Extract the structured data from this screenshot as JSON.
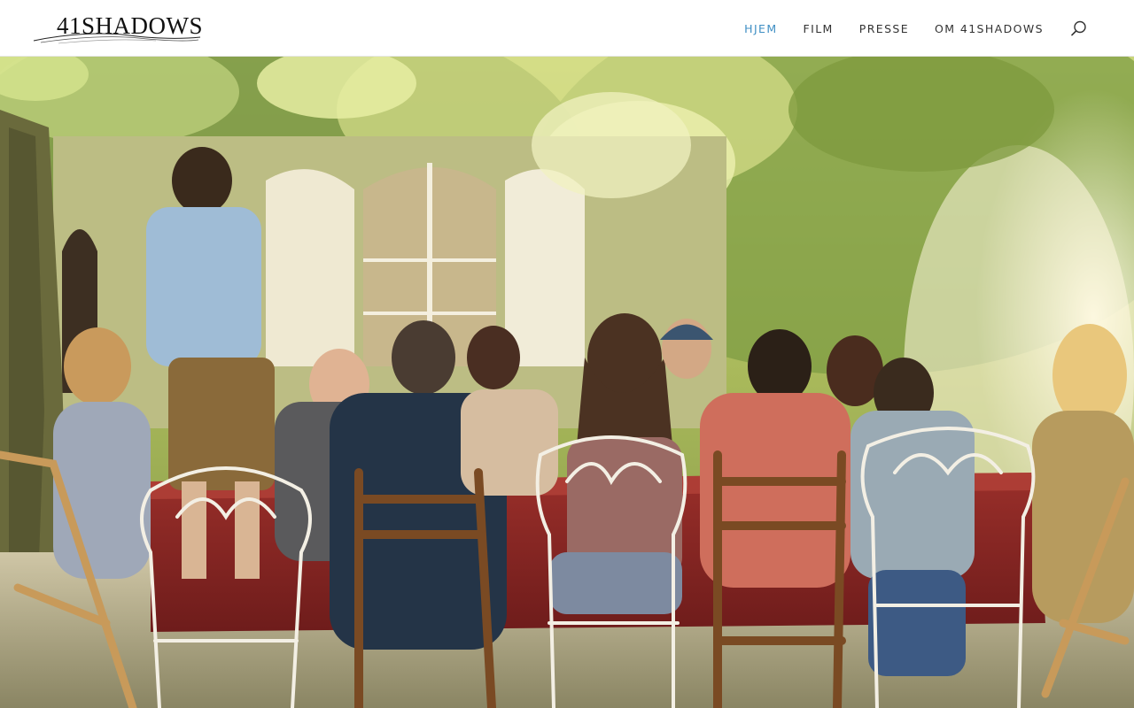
{
  "header": {
    "logo_text": "41SHADOWS",
    "nav": {
      "home": "HJEM",
      "film": "FILM",
      "press": "PRESSE",
      "about": "OM 41SHADOWS"
    },
    "active_color": "#3f8fc4",
    "search_icon": "search-icon"
  },
  "hero": {
    "image_subject": "hero-photo"
  }
}
